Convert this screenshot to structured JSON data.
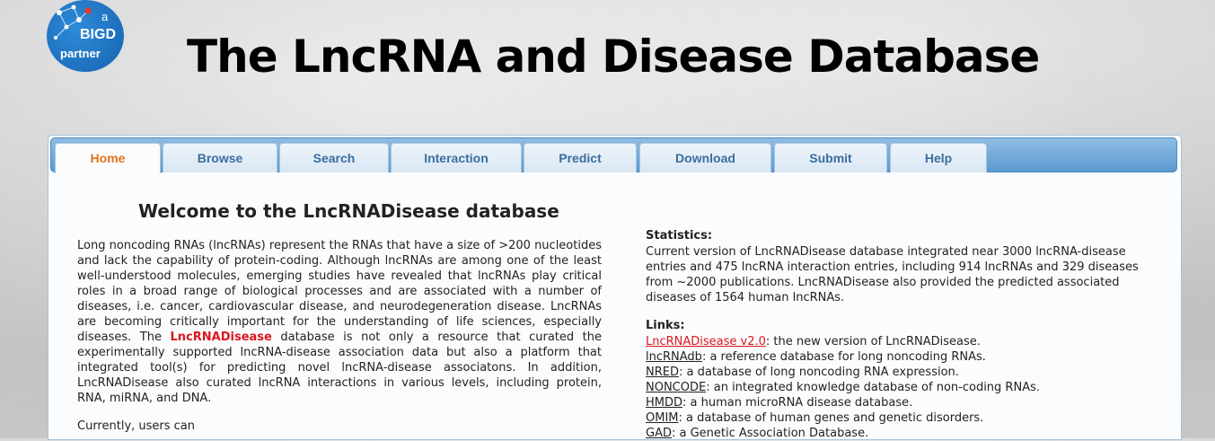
{
  "logo": {
    "a": "a",
    "name": "BIGD",
    "partner": "partner"
  },
  "site_title": "The LncRNA and Disease Database",
  "nav": {
    "tabs": [
      {
        "label": "Home",
        "active": true
      },
      {
        "label": "Browse"
      },
      {
        "label": "Search"
      },
      {
        "label": "Interaction"
      },
      {
        "label": "Predict"
      },
      {
        "label": "Download"
      },
      {
        "label": "Submit"
      },
      {
        "label": "Help"
      }
    ]
  },
  "main": {
    "welcome_title": "Welcome to the LncRNADisease database",
    "intro_before": "Long noncoding RNAs (lncRNAs) represent the RNAs that have a size of >200 nucleotides and lack the capability of protein-coding. Although lncRNAs are among one of the least well-understood molecules, emerging studies have revealed that lncRNAs play critical roles in a broad range of biological processes and are associated with a number of diseases, i.e. cancer, cardiovascular disease, and neurodegeneration disease. LncRNAs are becoming critically important for the understanding of life sciences, especially diseases. The ",
    "intro_highlight": "LncRNADisease",
    "intro_after": " database is not only a resource that curated the experimentally supported lncRNA-disease association data but also a platform that integrated tool(s) for predicting novel lncRNA-disease associatons. In addition, LncRNADisease also curated lncRNA interactions in various levels, including protein, RNA, miRNA, and DNA.",
    "currently": "Currently, users can"
  },
  "stats": {
    "heading": "Statistics:",
    "text": "Current version of LncRNADisease database integrated near 3000 lncRNA-disease entries and 475 lncRNA interaction entries, including 914 lncRNAs and 329 diseases from ~2000 publications. LncRNADisease also provided the predicted associated diseases of 1564 human lncRNAs."
  },
  "links": {
    "heading": "Links:",
    "items": [
      {
        "name": "LncRNADisease v2.0",
        "desc": ": the new version of LncRNADisease."
      },
      {
        "name": "lncRNAdb",
        "desc": ": a reference database for long noncoding RNAs."
      },
      {
        "name": "NRED",
        "desc": ": a database of long noncoding RNA expression."
      },
      {
        "name": "NONCODE",
        "desc": ": an integrated knowledge database of non-coding RNAs."
      },
      {
        "name": "HMDD",
        "desc": ": a human microRNA disease database."
      },
      {
        "name": "OMIM",
        "desc": ": a database of human genes and genetic disorders."
      },
      {
        "name": "GAD",
        "desc": ": a Genetic Association Database."
      }
    ]
  },
  "colors": {
    "active_tab": "#e2731c",
    "highlight": "#d9181e",
    "nav_blue": "#5a9ad0"
  }
}
